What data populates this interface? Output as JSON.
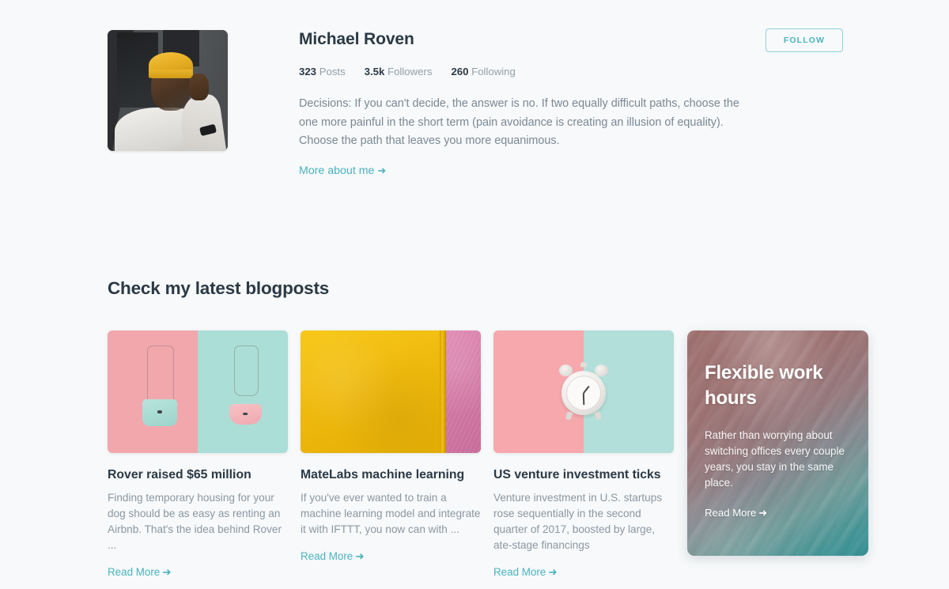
{
  "profile": {
    "name": "Michael Roven",
    "avatar_alt": "portrait-photo",
    "follow_label": "FOLLOW",
    "stats": [
      {
        "value": "323",
        "label": "Posts"
      },
      {
        "value": "3.5k",
        "label": "Followers"
      },
      {
        "value": "260",
        "label": "Following"
      }
    ],
    "bio": "Decisions: If you can't decide, the answer is no. If two equally difficult paths, choose the one more painful in the short term (pain avoidance is creating an illusion of equality). Choose the path that leaves you more equanimous.",
    "more_link": "More about me",
    "arrow": "➜"
  },
  "blog": {
    "heading": "Check my latest blogposts",
    "read_more": "Read More",
    "arrow": "➜",
    "posts": [
      {
        "image": "two-handbags-pink-mint",
        "title": "Rover raised $65 million",
        "excerpt": "Finding temporary housing for your dog should be as easy as renting an Airbnb. That's the idea behind Rover ..."
      },
      {
        "image": "yellow-notebook",
        "title": "MateLabs machine learning",
        "excerpt": "If you've ever wanted to train a machine learning model and integrate it with IFTTT, you now can with ..."
      },
      {
        "image": "alarm-clock-pink-mint",
        "title": "US venture investment ticks",
        "excerpt": "Venture investment in U.S. startups rose sequentially in the second quarter of 2017, boosted by large, ate-stage financings"
      }
    ]
  },
  "featured": {
    "title": "Flexible work hours",
    "description": "Rather than worrying about switching offices every couple years, you stay in the same place.",
    "read_more": "Read More",
    "arrow": "➜"
  },
  "colors": {
    "page_background": "#f7f9fa",
    "accent_teal": "#4ab3bf",
    "heading_dark": "#2b3945",
    "body_gray": "#8b97a2",
    "featured_top": "#9c6e6d",
    "featured_bottom": "#2f8b8f"
  }
}
